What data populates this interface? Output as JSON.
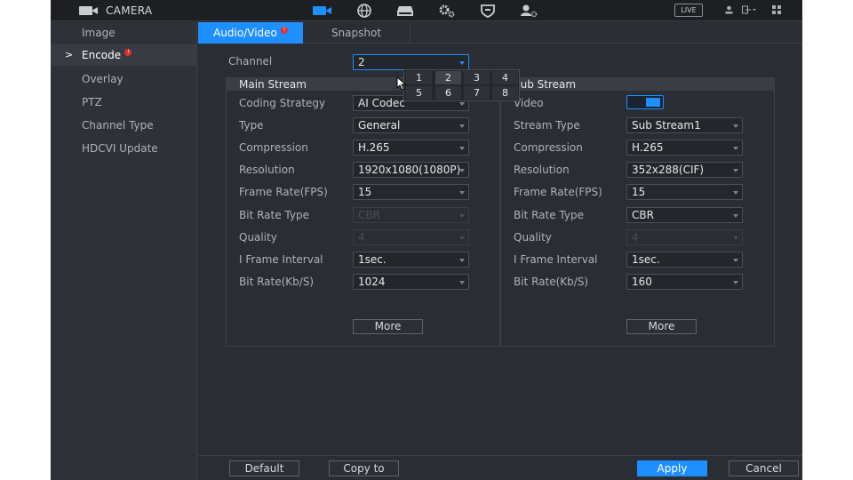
{
  "topbar": {
    "app_title": "CAMERA",
    "live_label": "LIVE",
    "nav_icons": [
      "camera-icon",
      "network-icon",
      "storage-icon",
      "system-icon",
      "security-icon",
      "account-icon"
    ],
    "right_icons": [
      "user-icon",
      "logout-icon",
      "grid-icon"
    ]
  },
  "sidebar": {
    "items": [
      {
        "label": "Image",
        "active": false
      },
      {
        "label": "Encode",
        "active": true,
        "badge": true
      },
      {
        "label": "Overlay",
        "active": false
      },
      {
        "label": "PTZ",
        "active": false
      },
      {
        "label": "Channel Type",
        "active": false
      },
      {
        "label": "HDCVI Update",
        "active": false
      }
    ],
    "arrow": ">"
  },
  "tabs": [
    {
      "label": "Audio/Video",
      "active": true,
      "badge": true
    },
    {
      "label": "Snapshot",
      "active": false
    }
  ],
  "channel": {
    "label": "Channel",
    "value": "2",
    "options": [
      "1",
      "2",
      "3",
      "4",
      "5",
      "6",
      "7",
      "8"
    ],
    "hovered_option": "2"
  },
  "main_stream": {
    "title": "Main Stream",
    "rows": [
      {
        "label": "Coding Strategy",
        "value": "AI Codec",
        "disabled": false
      },
      {
        "label": "Type",
        "value": "General",
        "disabled": false
      },
      {
        "label": "Compression",
        "value": "H.265",
        "disabled": false
      },
      {
        "label": "Resolution",
        "value": "1920x1080(1080P)",
        "disabled": false
      },
      {
        "label": "Frame Rate(FPS)",
        "value": "15",
        "disabled": false
      },
      {
        "label": "Bit Rate Type",
        "value": "CBR",
        "disabled": true
      },
      {
        "label": "Quality",
        "value": "4",
        "disabled": true
      },
      {
        "label": "I Frame Interval",
        "value": "1sec.",
        "disabled": false
      },
      {
        "label": "Bit Rate(Kb/S)",
        "value": "1024",
        "disabled": false
      }
    ],
    "more_label": "More"
  },
  "sub_stream": {
    "title": "Sub Stream",
    "video_label": "Video",
    "video_enabled": true,
    "rows": [
      {
        "label": "Stream Type",
        "value": "Sub Stream1",
        "disabled": false
      },
      {
        "label": "Compression",
        "value": "H.265",
        "disabled": false
      },
      {
        "label": "Resolution",
        "value": "352x288(CIF)",
        "disabled": false
      },
      {
        "label": "Frame Rate(FPS)",
        "value": "15",
        "disabled": false
      },
      {
        "label": "Bit Rate Type",
        "value": "CBR",
        "disabled": false
      },
      {
        "label": "Quality",
        "value": "4",
        "disabled": true
      },
      {
        "label": "I Frame Interval",
        "value": "1sec.",
        "disabled": false
      },
      {
        "label": "Bit Rate(Kb/S)",
        "value": "160",
        "disabled": false
      }
    ],
    "more_label": "More"
  },
  "bottom": {
    "default_label": "Default",
    "copy_label": "Copy to",
    "apply_label": "Apply",
    "cancel_label": "Cancel"
  },
  "colors": {
    "accent": "#1e8fff",
    "badge": "#e0302f",
    "background": "#2a2d33"
  }
}
